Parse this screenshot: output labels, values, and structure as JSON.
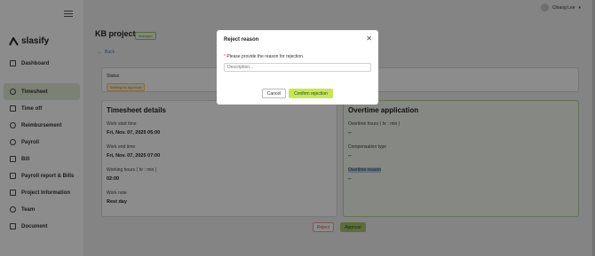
{
  "app": {
    "logo_text": "slasify"
  },
  "sidebar": {
    "items": [
      {
        "label": "Dashboard",
        "icon": "dashboard-icon"
      },
      {
        "label": "Timesheet",
        "icon": "timesheet-icon",
        "active": true
      },
      {
        "label": "Time off",
        "icon": "calendar-icon"
      },
      {
        "label": "Reimbursement",
        "icon": "reimbursement-icon"
      },
      {
        "label": "Payroll",
        "icon": "payroll-icon"
      },
      {
        "label": "Bill",
        "icon": "bill-icon"
      },
      {
        "label": "Payroll report & Bills",
        "icon": "report-icon"
      },
      {
        "label": "Project Information",
        "icon": "project-icon"
      },
      {
        "label": "Team",
        "icon": "team-icon"
      },
      {
        "label": "Document",
        "icon": "document-icon"
      }
    ]
  },
  "header": {
    "user_name": "Chiang Lee"
  },
  "page": {
    "title": "KB project",
    "badge": "Manager",
    "back_label": "Back",
    "status_label": "Status",
    "status_value": "Waiting for approval"
  },
  "timesheet": {
    "title": "Timesheet details",
    "fields": [
      {
        "label": "Work start time",
        "value": "Fri, Nov. 07, 2025 05:00"
      },
      {
        "label": "Work end time",
        "value": "Fri, Nov. 07, 2025 07:00"
      },
      {
        "label": "Working hours ( hr : min )",
        "value": "02:00"
      },
      {
        "label": "Work note",
        "value": "Rest day"
      }
    ]
  },
  "overtime": {
    "title": "Overtime application",
    "fields": [
      {
        "label": "Overtime hours ( hr : min )",
        "value": "--"
      },
      {
        "label": "Compensation type",
        "value": "--"
      },
      {
        "label": "Overtime reason",
        "value": "--"
      }
    ]
  },
  "actions": {
    "reject_label": "Reject",
    "approve_label": "Approve"
  },
  "modal": {
    "title": "Reject reason",
    "required_mark": "*",
    "prompt": "Please provide the reason for rejection.",
    "input_placeholder": "Description...",
    "input_value": "",
    "cancel_label": "Cancel",
    "confirm_label": "Confirm rejection"
  },
  "colors": {
    "accent": "#c4e85a",
    "active_nav": "#e2ecd6",
    "overlay": "#000000"
  }
}
